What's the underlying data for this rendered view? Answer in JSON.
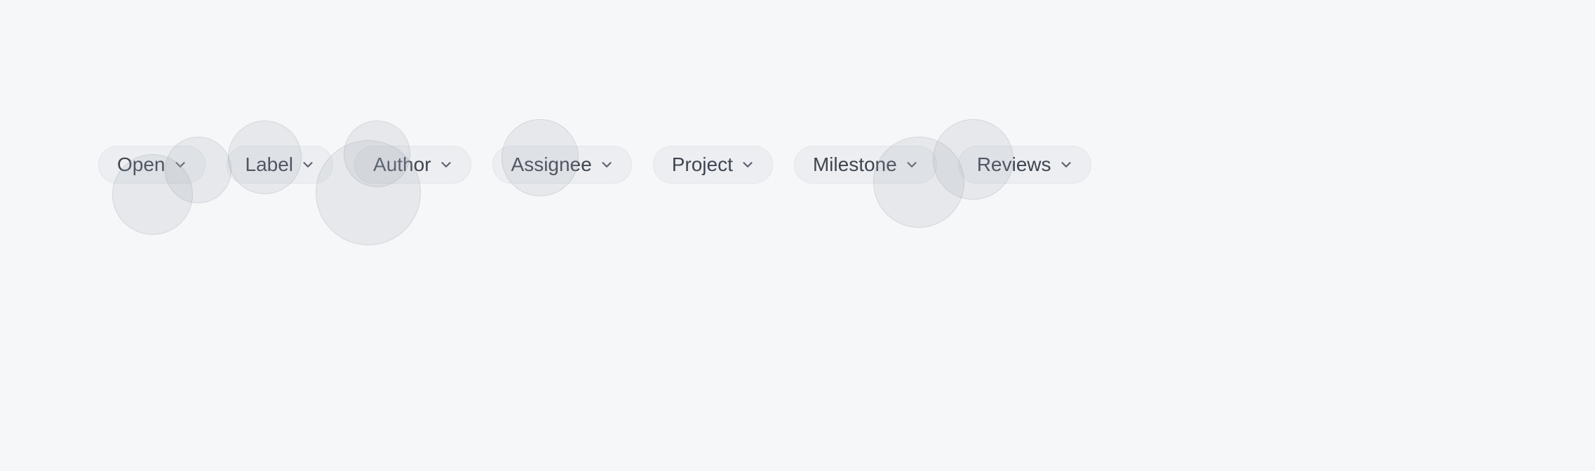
{
  "filters": [
    {
      "label": "Open"
    },
    {
      "label": "Label"
    },
    {
      "label": "Author"
    },
    {
      "label": "Assignee"
    },
    {
      "label": "Project"
    },
    {
      "label": "Milestone"
    },
    {
      "label": "Reviews"
    }
  ]
}
